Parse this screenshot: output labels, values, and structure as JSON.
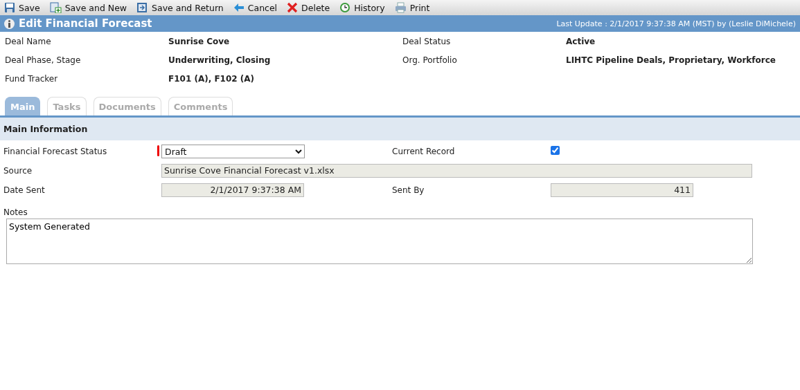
{
  "toolbar": [
    {
      "kind": "save",
      "label": "Save"
    },
    {
      "kind": "save-new",
      "label": "Save and New"
    },
    {
      "kind": "save-return",
      "label": "Save and Return"
    },
    {
      "kind": "cancel",
      "label": "Cancel"
    },
    {
      "kind": "delete",
      "label": "Delete"
    },
    {
      "kind": "history",
      "label": "History"
    },
    {
      "kind": "print",
      "label": "Print"
    }
  ],
  "header": {
    "title": "Edit Financial Forecast",
    "last_update": "Last Update : 2/1/2017 9:37:38 AM (MST) by (Leslie DiMichele)"
  },
  "summary": [
    {
      "label": "Deal Name",
      "value": "Sunrise Cove"
    },
    {
      "label": "Deal Status",
      "value": "Active"
    },
    {
      "label": "Deal Phase, Stage",
      "value": "Underwriting, Closing"
    },
    {
      "label": "Org. Portfolio",
      "value": "LIHTC Pipeline Deals, Proprietary, Workforce"
    },
    {
      "label": "Fund Tracker",
      "value": "F101 (A), F102 (A)"
    }
  ],
  "tabs": [
    {
      "label": "Main",
      "selected": true
    },
    {
      "label": "Tasks",
      "selected": false
    },
    {
      "label": "Documents",
      "selected": false
    },
    {
      "label": "Comments",
      "selected": false
    }
  ],
  "section": {
    "title": "Main Information"
  },
  "form": {
    "status": {
      "label": "Financial Forecast Status",
      "value": "Draft",
      "required": true
    },
    "current_record": {
      "label": "Current Record",
      "checked": true
    },
    "source": {
      "label": "Source",
      "value": "Sunrise Cove Financial Forecast v1.xlsx"
    },
    "date_sent": {
      "label": "Date Sent",
      "value": "2/1/2017 9:37:38 AM"
    },
    "sent_by": {
      "label": "Sent By",
      "value": "411"
    },
    "notes": {
      "label": "Notes",
      "value": "System Generated"
    }
  }
}
